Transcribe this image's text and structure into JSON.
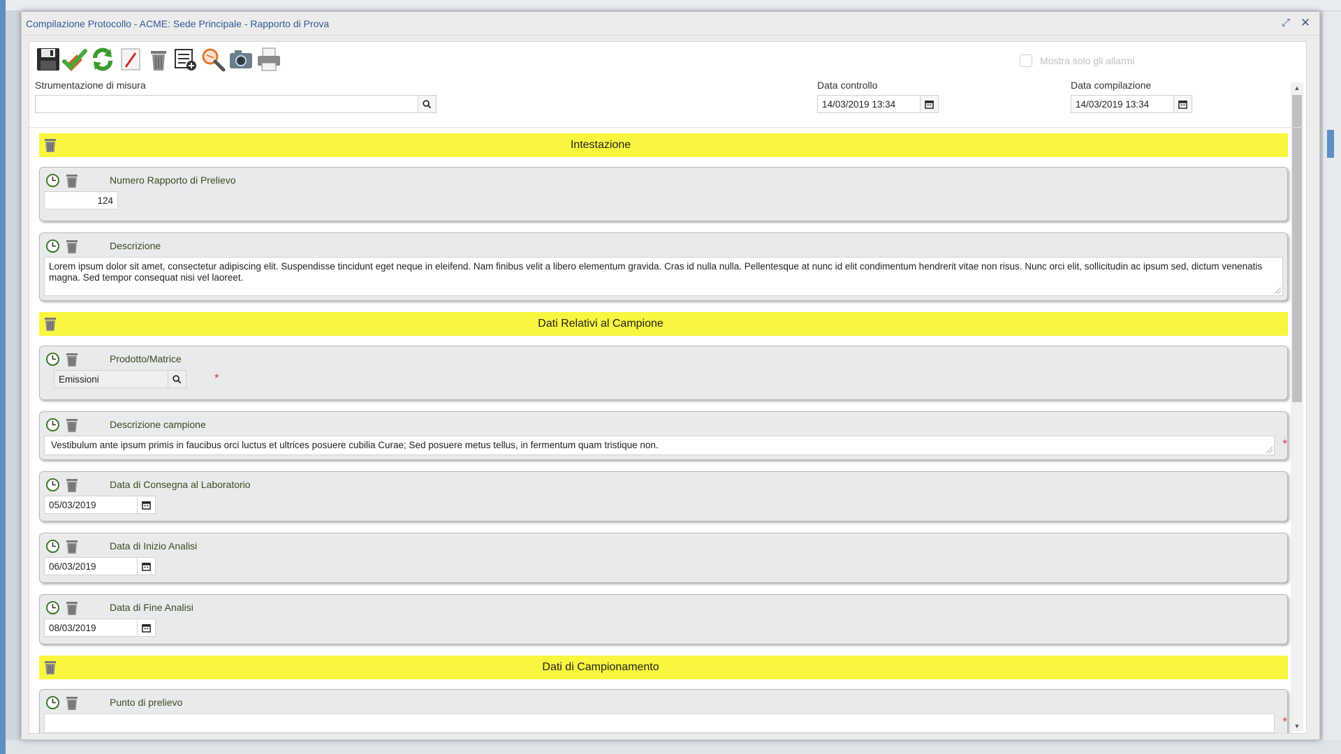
{
  "window": {
    "title": "Compilazione Protocollo - ACME: Sede Principale - Rapporto di Prova",
    "maximize_glyph": "⤢",
    "close_glyph": "✕"
  },
  "toolbar": {
    "buttons": [
      "save-icon",
      "confirm-icon",
      "refresh-icon",
      "edit-icon",
      "delete-icon",
      "add-list-icon",
      "search-zoom-icon",
      "camera-icon",
      "print-icon"
    ],
    "alarm_filter_label": "Mostra solo gli allarmi"
  },
  "header": {
    "instrument_label": "Strumentazione di misura",
    "instrument_value": "",
    "check_date_label": "Data controllo",
    "check_date_value": "14/03/2019 13:34",
    "fill_date_label": "Data compilazione",
    "fill_date_value": "14/03/2019 13:34"
  },
  "sections": {
    "s1_title": "Intestazione",
    "s2_title": "Dati Relativi al Campione",
    "s3_title": "Dati di Campionamento"
  },
  "fields": {
    "report_number_label": "Numero Rapporto di Prelievo",
    "report_number_value": "124",
    "description_label": "Descrizione",
    "description_value": "Lorem ipsum dolor sit amet, consectetur adipiscing elit. Suspendisse tincidunt eget neque in eleifend. Nam finibus velit a libero elementum gravida. Cras id nulla nulla. Pellentesque at nunc id elit condimentum hendrerit vitae non risus. Nunc orci elit, sollicitudin ac ipsum sed, dictum venenatis magna. Sed tempor consequat nisi vel laoreet.",
    "product_label": "Prodotto/Matrice",
    "product_value": "Emissioni",
    "sample_desc_label": "Descrizione campione",
    "sample_desc_value": "Vestibulum ante ipsum primis in faucibus orci luctus et ultrices posuere cubilia Curae; Sed posuere metus tellus, in fermentum quam tristique non.",
    "delivery_date_label": "Data di Consegna al Laboratorio",
    "delivery_date_value": "05/03/2019",
    "start_date_label": "Data di Inizio Analisi",
    "start_date_value": "06/03/2019",
    "end_date_label": "Data di Fine Analisi",
    "end_date_value": "08/03/2019",
    "sampling_point_label": "Punto di prelievo",
    "required_mark": "*"
  },
  "colors": {
    "section_bar": "#f8f63e",
    "title_text": "#2d5c9a",
    "field_label": "#3c4a1c",
    "required": "#e23a3a"
  }
}
